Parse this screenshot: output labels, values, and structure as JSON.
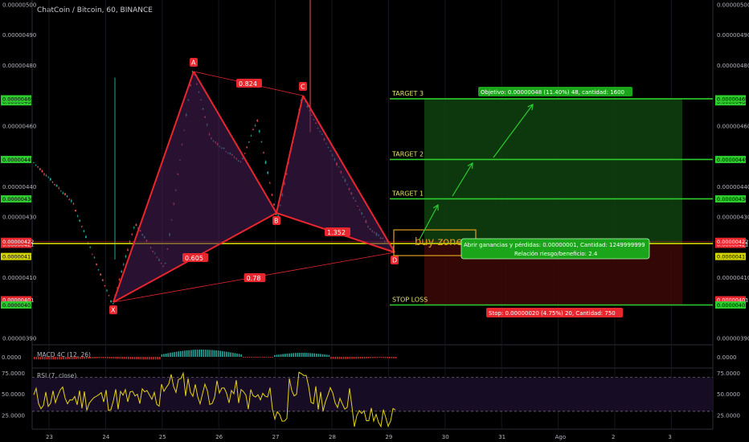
{
  "header": {
    "symbol_title": "ChatCoin / Bitcoin, 60, BINANCE"
  },
  "colors": {
    "up": "#26a69a",
    "down": "#ef5350",
    "target_line": "#2ecc2e",
    "stop_line": "#2ecc2e",
    "entry_line": "#d4d400",
    "pattern": "#e8262e",
    "pattern_fill": "#4a1f5a",
    "profit_zone": "#0e3d0e",
    "loss_zone": "#3a0808",
    "rsi_line": "#e6d21a",
    "rsi_bg": "#160d24"
  },
  "chart_data": [
    {
      "type": "candlestick",
      "title": "ChatCoin / Bitcoin, 60, BINANCE",
      "ylim": [
        3.86e-06,
        5.01e-06
      ],
      "y_ticks": [
        "0.00000390",
        "0.00000401",
        "0.00000410",
        "0.00000417",
        "0.00000421",
        "0.00000422",
        "0.00000430",
        "0.00000436",
        "0.00000440",
        "0.00000449",
        "0.00000460",
        "0.00000468",
        "0.00000469",
        "0.00000480",
        "0.00000490",
        "0.00000500"
      ],
      "x_tick_labels": [
        "23",
        "24",
        "25",
        "26",
        "27",
        "28",
        "29",
        "30",
        "31",
        "Ago",
        "2",
        "3"
      ],
      "pattern_points": [
        {
          "name": "X",
          "x": "24",
          "price": 4.01e-06
        },
        {
          "name": "A",
          "x": "25",
          "price": 4.79e-06
        },
        {
          "name": "B",
          "x": "27",
          "price": 4.29e-06
        },
        {
          "name": "C",
          "x": "27",
          "price": 4.7e-06
        },
        {
          "name": "D",
          "x": "29",
          "price": 4.2e-06
        }
      ],
      "ratios": [
        "0.824",
        "0.605",
        "1.352",
        "0.78"
      ],
      "levels": [
        {
          "label": "TARGET 3",
          "price": 4.69e-06
        },
        {
          "label": "TARGET 2",
          "price": 4.49e-06
        },
        {
          "label": "TARGET 1",
          "price": 4.36e-06
        },
        {
          "label": "STOP LOSS",
          "price": 4.01e-06
        }
      ],
      "entry_price": 4.21e-06,
      "buy_zone_label": "buy zone",
      "target_box": "Objetivo: 0.00000048 (11.40%) 48, cantidad: 1600",
      "info_box_line1": "Abrir ganancias y pérdidas: 0.00000001, Cantidad: 1249999999",
      "info_box_line2": "Relación riesgo/beneficio: 2.4",
      "stop_box": "Stop: 0.00000020 (4.75%) 20, Cantidad: 750"
    },
    {
      "type": "bar",
      "title": "MACD 4C (12, 26)",
      "y_ticks": [
        "0.0000"
      ]
    },
    {
      "type": "line",
      "title": "RSI (7, close)",
      "ylim": [
        10,
        80
      ],
      "y_ticks": [
        "75.0000",
        "50.0000",
        "25.0000"
      ],
      "bands": [
        70,
        30
      ]
    }
  ],
  "indicators": {
    "macd_label": "MACD 4C (12, 26)",
    "rsi_label": "RSI (7, close)"
  }
}
